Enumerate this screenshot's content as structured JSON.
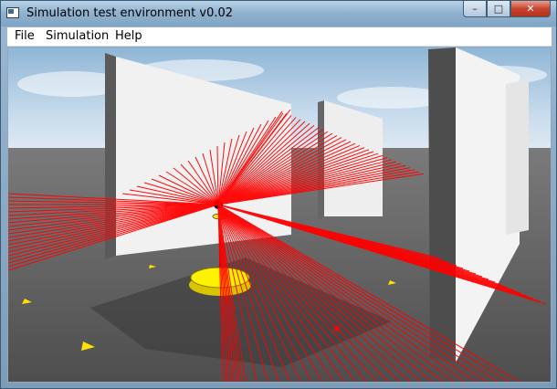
{
  "window": {
    "title": "Simulation test environment v0.02",
    "controls": {
      "minimize": "–",
      "maximize": "□",
      "close": "✕"
    }
  },
  "menu": {
    "items": [
      {
        "label": "File"
      },
      {
        "label": "Simulation"
      },
      {
        "label": "Help"
      }
    ]
  },
  "scene": {
    "description_colors": {
      "laser": "#ff0000",
      "robot": "#ffe600",
      "walls": "#f2f2f2",
      "floor": "#5d5d5d"
    }
  }
}
